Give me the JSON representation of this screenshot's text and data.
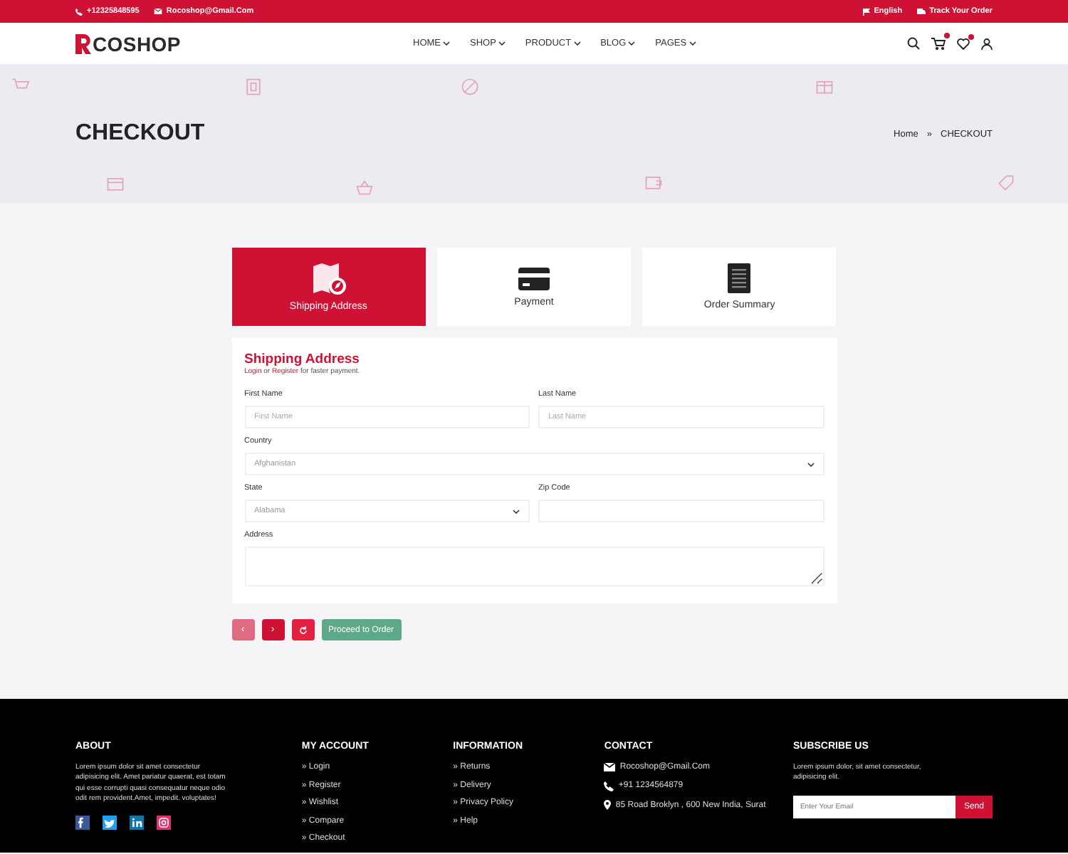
{
  "topbar": {
    "phone": "+12325848595",
    "email": "Rocoshop@Gmail.Com",
    "language": "English",
    "track": "Track Your Order"
  },
  "header": {
    "logo": "COSHOP",
    "nav": [
      {
        "label": "HOME"
      },
      {
        "label": "SHOP"
      },
      {
        "label": "PRODUCT"
      },
      {
        "label": "BLOG"
      },
      {
        "label": "PAGES"
      }
    ]
  },
  "banner": {
    "title": "CHECKOUT",
    "breadcrumb": [
      "Home",
      "CHECKOUT"
    ],
    "separator": "»"
  },
  "steps": [
    {
      "label": "Shipping Address",
      "kind": "map",
      "selected": true
    },
    {
      "label": "Payment",
      "kind": "card",
      "selected": false
    },
    {
      "label": "Order Summary",
      "kind": "receipt",
      "selected": false
    }
  ],
  "form": {
    "title": "Shipping Address",
    "login": "Login",
    "or": "or",
    "register": "Register",
    "note": "for faster payment.",
    "fields": [
      {
        "kind": "text",
        "label": "First Name",
        "placeholder": "First Name",
        "half": true
      },
      {
        "kind": "text",
        "label": "Last Name",
        "placeholder": "Last Name",
        "half": true
      },
      {
        "kind": "select",
        "label": "Country",
        "value": "Afghanistan",
        "half": false
      },
      {
        "kind": "select",
        "label": "State",
        "value": "Alabama",
        "half": true
      },
      {
        "kind": "text",
        "label": "Zip Code",
        "half": true
      },
      {
        "kind": "textarea",
        "label": "Address",
        "half": false
      }
    ]
  },
  "actions": [
    {
      "kind": "prev",
      "label": "‹",
      "disabled": true
    },
    {
      "kind": "next",
      "label": "›",
      "disabled": false
    },
    {
      "kind": "reset",
      "disabled": false
    },
    {
      "kind": "proceed",
      "label": "Proceed to Order",
      "disabled": false
    }
  ],
  "footer": {
    "about": {
      "heading": "ABOUT",
      "text": "Lorem ipsum dolor sit amet consectetur adipisicing elit. Amet pariatur quaerat, est totam qui esse corrupti quasi consequatur neque odio odit rem provident.Amet, impedit. voluptates!",
      "socials": [
        {
          "kind": "facebook",
          "color": "#3b5998"
        },
        {
          "kind": "twitter",
          "color": "#1da1f2"
        },
        {
          "kind": "linkedin",
          "color": "#0e76a8"
        },
        {
          "kind": "instagram",
          "color": "#e1306c"
        }
      ]
    },
    "account": {
      "heading": "MY ACCOUNT",
      "links": [
        "» Login",
        "» Register",
        "» Wishlist",
        "» Compare",
        "» Checkout"
      ]
    },
    "information": {
      "heading": "INFORMATION",
      "links": [
        "» Returns",
        "» Delivery",
        "» Privacy Policy",
        "» Help"
      ]
    },
    "contact": {
      "heading": "CONTACT",
      "items": [
        {
          "kind": "email",
          "text": "Rocoshop@Gmail.Com"
        },
        {
          "kind": "phone",
          "text": "+91 1234564879"
        },
        {
          "kind": "location",
          "text": "85 Road Broklyn , 600 New India, Surat"
        }
      ]
    },
    "subscribe": {
      "heading": "SUBSCRIBE US",
      "text": "Lorem ipsum dolor, sit amet consectetur, adipisicing elit.",
      "placeholder": "Enter Your Email",
      "button": "Send"
    }
  }
}
